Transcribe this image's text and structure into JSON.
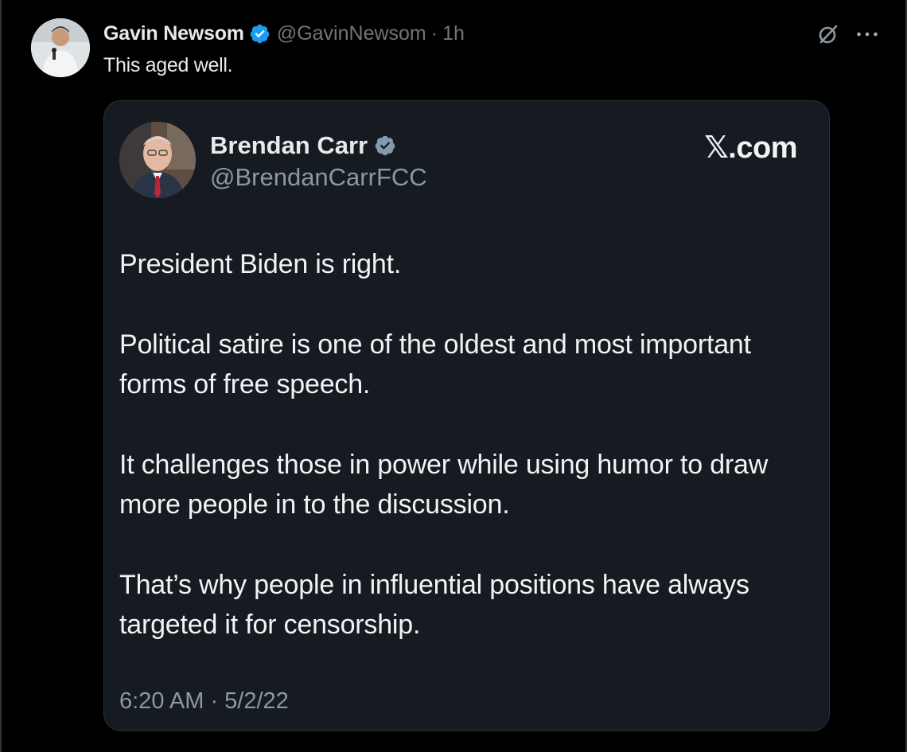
{
  "tweet": {
    "author_name": "Gavin Newsom",
    "handle": "@GavinNewsom",
    "separator": "·",
    "time": "1h",
    "text": "This aged well."
  },
  "quoted": {
    "author_name": "Brendan Carr",
    "handle": "@BrendanCarrFCC",
    "brand": "𝕏.com",
    "paragraphs": [
      "President Biden is right.",
      "Political satire is one of the oldest and most important forms of free speech.",
      "It challenges those in power while using humor to draw more people in to the discussion.",
      "That’s why people in influential positions have always targeted it for censorship."
    ],
    "timestamp": "6:20 AM · 5/2/22"
  },
  "icons": {
    "verified": "verified-badge-icon",
    "quoted_verified": "verified-badge-icon",
    "grok": "grok-icon",
    "more": "more-options-icon"
  },
  "colors": {
    "background": "#000000",
    "verified_blue": "#1d9bf0",
    "verified_gray": "#829aab",
    "secondary_text": "#71767b",
    "card": "#161b22"
  }
}
